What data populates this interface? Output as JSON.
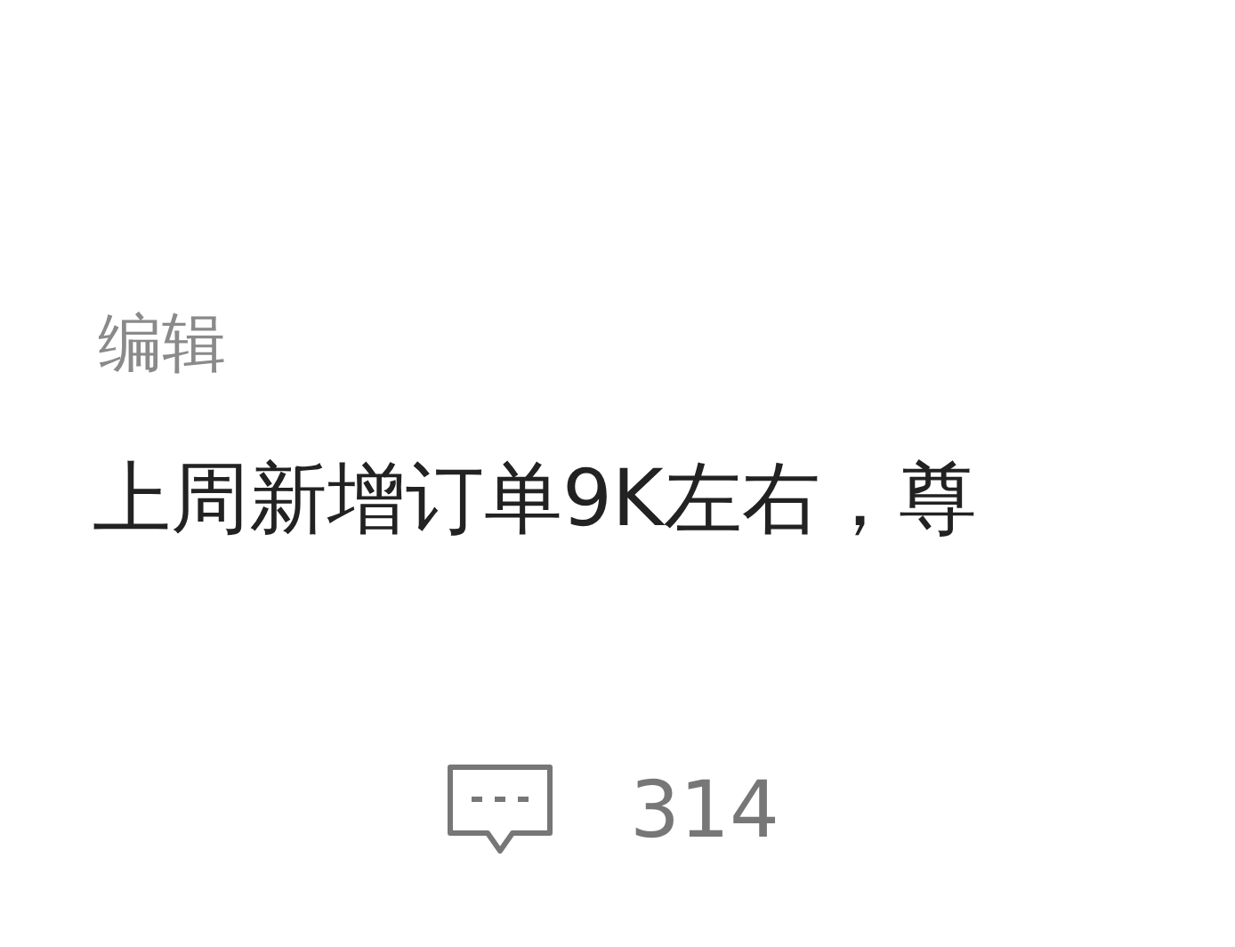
{
  "post": {
    "edit_label": "编辑",
    "text": "上周新增订单9K左右，尊"
  },
  "actions": [
    {
      "kind": "comment",
      "count": "314"
    }
  ]
}
